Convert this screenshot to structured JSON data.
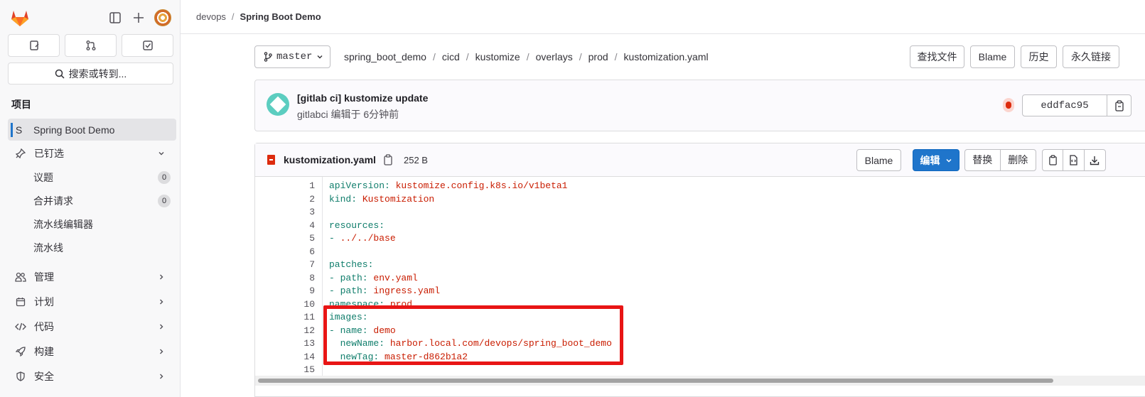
{
  "sidebar": {
    "section_title": "项目",
    "search_label": "搜索或转到...",
    "project": {
      "initial": "S",
      "name": "Spring Boot Demo"
    },
    "pinned_label": "已钉选",
    "pinned_items": [
      {
        "label": "议题",
        "count": "0"
      },
      {
        "label": "合并请求",
        "count": "0"
      },
      {
        "label": "流水线编辑器"
      },
      {
        "label": "流水线"
      }
    ],
    "groups": [
      {
        "label": "管理",
        "icon": "users-icon"
      },
      {
        "label": "计划",
        "icon": "calendar-icon"
      },
      {
        "label": "代码",
        "icon": "code-icon"
      },
      {
        "label": "构建",
        "icon": "rocket-icon"
      },
      {
        "label": "安全",
        "icon": "shield-icon"
      }
    ]
  },
  "breadcrumb": {
    "group": "devops",
    "project": "Spring Boot Demo"
  },
  "repo": {
    "branch": "master",
    "path": [
      "spring_boot_demo",
      "cicd",
      "kustomize",
      "overlays",
      "prod",
      "kustomization.yaml"
    ],
    "actions": {
      "find_file": "查找文件",
      "blame": "Blame",
      "history": "历史",
      "permalink": "永久链接"
    }
  },
  "commit": {
    "title": "[gitlab ci] kustomize update",
    "author": "gitlabci",
    "meta": "编辑于 6分钟前",
    "sha": "eddfac95"
  },
  "file": {
    "name": "kustomization.yaml",
    "size": "252 B",
    "actions": {
      "blame": "Blame",
      "edit": "编辑",
      "replace": "替换",
      "delete": "删除"
    }
  },
  "code_lines": [
    {
      "n": "1",
      "k": "apiVersion:",
      "v": " kustomize.config.k8s.io/v1beta1"
    },
    {
      "n": "2",
      "k": "kind:",
      "v": " Kustomization"
    },
    {
      "n": "3",
      "k": "",
      "v": ""
    },
    {
      "n": "4",
      "k": "resources:",
      "v": ""
    },
    {
      "n": "5",
      "k": "- ",
      "v": "../../base"
    },
    {
      "n": "6",
      "k": "",
      "v": ""
    },
    {
      "n": "7",
      "k": "patches:",
      "v": ""
    },
    {
      "n": "8",
      "k": "- path:",
      "v": " env.yaml"
    },
    {
      "n": "9",
      "k": "- path:",
      "v": " ingress.yaml"
    },
    {
      "n": "10",
      "k": "namespace:",
      "v": " prod"
    },
    {
      "n": "11",
      "k": "images:",
      "v": ""
    },
    {
      "n": "12",
      "k": "- name:",
      "v": " demo"
    },
    {
      "n": "13",
      "k": "  newName:",
      "v": " harbor.local.com/devops/spring_boot_demo"
    },
    {
      "n": "14",
      "k": "  newTag:",
      "v": " master-d862b1a2"
    },
    {
      "n": "15",
      "k": "",
      "v": ""
    }
  ],
  "colors": {
    "accent": "#1f75cb",
    "highlight_border": "#e81515",
    "yaml_key": "#0f7d6b",
    "yaml_value": "#c91c00"
  }
}
